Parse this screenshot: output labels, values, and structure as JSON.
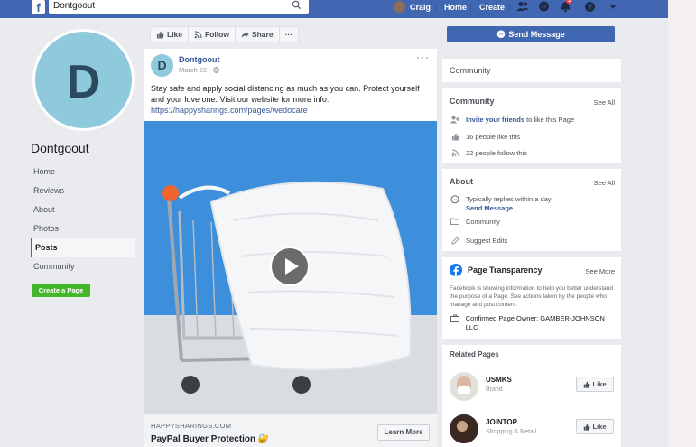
{
  "topbar": {
    "search_value": "Dontgoout",
    "user_name": "Craig",
    "home_label": "Home",
    "create_label": "Create",
    "notification_count": "1"
  },
  "profile": {
    "initial": "D",
    "page_name": "Dontgoout"
  },
  "left_nav": {
    "items": [
      "Home",
      "Reviews",
      "About",
      "Photos",
      "Posts",
      "Community"
    ],
    "active": "Posts",
    "create_page_label": "Create a Page"
  },
  "action_bar": {
    "like_label": "Like",
    "follow_label": "Follow",
    "share_label": "Share",
    "more_label": "···"
  },
  "post": {
    "avatar_initial": "D",
    "author": "Dontgoout",
    "date": "March 22 ·",
    "more": "···",
    "text": "Stay safe and apply social distancing as much as you can. Protect yourself and your love one. Visit our website for more info:",
    "link": "https://happysharings.com/pages/wedocare",
    "link_domain": "HAPPYSHARINGS.COM",
    "link_title": "PayPal Buyer Protection 🔐",
    "learn_more_label": "Learn More"
  },
  "right": {
    "send_message_label": "Send Message",
    "community_tab_label": "Community",
    "community_card": {
      "title": "Community",
      "see_all": "See All",
      "invite_link": "Invite your friends",
      "invite_rest": " to like this Page",
      "likes": "16 people like this",
      "follows": "22 people follow this"
    },
    "about_card": {
      "title": "About",
      "see_all": "See All",
      "reply_text": "Typically replies within a day",
      "send_message_link": "Send Message",
      "community": "Community",
      "suggest_edits": "Suggest Edits"
    },
    "transparency_card": {
      "title": "Page Transparency",
      "see_more": "See More",
      "description": "Facebook is showing information to help you better understand the purpose of a Page. See actions taken by the people who manage and post content.",
      "owner": "Confirmed Page Owner: GAMBER-JOHNSON LLC"
    },
    "related_pages": {
      "title": "Related Pages",
      "like_label": "Like",
      "items": [
        {
          "name": "USMKS",
          "category": "Brand"
        },
        {
          "name": "JOINTOP",
          "category": "Shopping & Retail"
        }
      ]
    }
  },
  "colors": {
    "facebook_blue": "#4267b2",
    "link_blue": "#385898",
    "create_green": "#42b72a",
    "media_blue": "#3d8fdb",
    "profile_circle": "#8ec9dc"
  }
}
